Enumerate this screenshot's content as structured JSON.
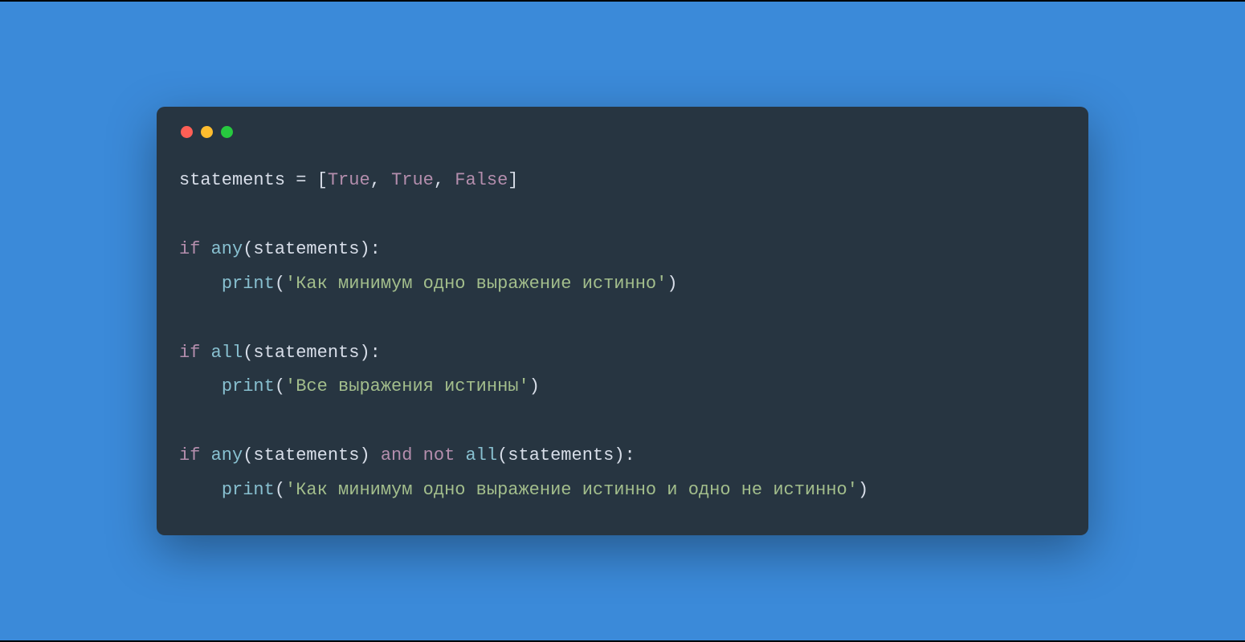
{
  "code": {
    "line1": {
      "var": "statements",
      "eq": " = ",
      "lb": "[",
      "v1": "True",
      "c1": ", ",
      "v2": "True",
      "c2": ", ",
      "v3": "False",
      "rb": "]"
    },
    "blank1": "",
    "line3": {
      "kw_if": "if",
      "sp1": " ",
      "fn": "any",
      "lp": "(",
      "arg": "statements",
      "rp": ")",
      "colon": ":"
    },
    "line4": {
      "indent": "    ",
      "fn": "print",
      "lp": "(",
      "str": "'Как минимум одно выражение истинно'",
      "rp": ")"
    },
    "blank2": "",
    "line6": {
      "kw_if": "if",
      "sp1": " ",
      "fn": "all",
      "lp": "(",
      "arg": "statements",
      "rp": ")",
      "colon": ":"
    },
    "line7": {
      "indent": "    ",
      "fn": "print",
      "lp": "(",
      "str": "'Все выражения истинны'",
      "rp": ")"
    },
    "blank3": "",
    "line9": {
      "kw_if": "if",
      "sp1": " ",
      "fn1": "any",
      "lp1": "(",
      "arg1": "statements",
      "rp1": ")",
      "sp2": " ",
      "kw_and": "and",
      "sp3": " ",
      "kw_not": "not",
      "sp4": " ",
      "fn2": "all",
      "lp2": "(",
      "arg2": "statements",
      "rp2": ")",
      "colon": ":"
    },
    "line10": {
      "indent": "    ",
      "fn": "print",
      "lp": "(",
      "str": "'Как минимум одно выражение истинно и одно не истинно'",
      "rp": ")"
    }
  }
}
